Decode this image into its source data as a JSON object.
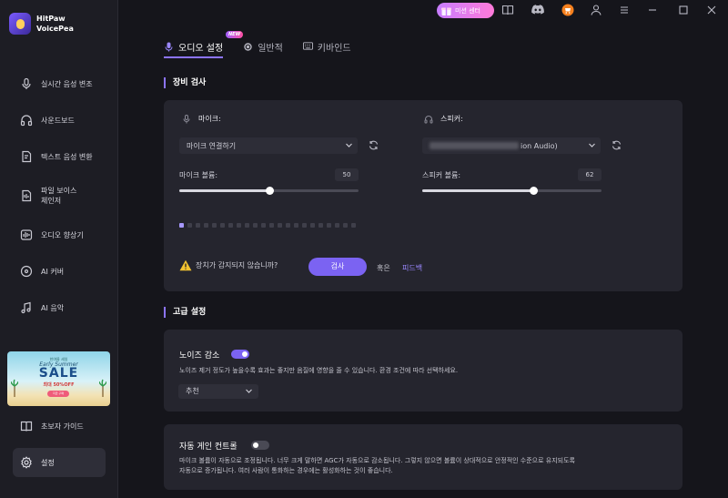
{
  "app": {
    "name_line1": "HitPaw",
    "name_line2": "VoicePea"
  },
  "sidebar": {
    "items": [
      {
        "label": "실시간 음성 변조",
        "icon": "mic-wave-icon"
      },
      {
        "label": "사운드보드",
        "icon": "headphones-icon"
      },
      {
        "label": "텍스트 음성 변환",
        "icon": "text-to-speech-icon"
      },
      {
        "label_line1": "파일 보이스",
        "label_line2": "체인저",
        "icon": "file-voice-icon"
      },
      {
        "label": "오디오 향상기",
        "icon": "audio-enhance-icon"
      },
      {
        "label": "AI 커버",
        "icon": "ai-cover-icon"
      },
      {
        "label": "AI 음악",
        "icon": "ai-music-icon"
      }
    ],
    "guide_label": "초보자 가이드",
    "settings_label": "설정",
    "banner": {
      "top": "한여름 세일",
      "subtitle": "Early Summer",
      "title": "SALE",
      "discount": "최대 50%OFF",
      "button": "지금 구매"
    }
  },
  "topbar": {
    "mission_label": "미션 센터"
  },
  "tabs": [
    {
      "label": "오디오 설정",
      "active": true,
      "badge": "NEW"
    },
    {
      "label": "일반적",
      "active": false
    },
    {
      "label": "키바인드",
      "active": false
    }
  ],
  "device_check": {
    "title": "장비 검사",
    "mic": {
      "label": "마이크:",
      "selected": "마이크 연결하기",
      "volume_label": "마이크 볼륨:",
      "volume": 50
    },
    "speaker": {
      "label": "스피커:",
      "selected_suffix": "ion Audio)",
      "volume_label": "스피커 볼륨:",
      "volume": 62
    },
    "meter_total": 22,
    "meter_active": 1,
    "warning_text": "장치가 감지되지 않습니까?",
    "check_button": "검사",
    "or_text": "혹은",
    "feedback_link": "피드백"
  },
  "advanced": {
    "title": "고급 설정",
    "noise": {
      "title": "노이즈 감소",
      "enabled": true,
      "description": "노이즈 제거 정도가 높을수록 효과는 좋지만 음질에 영향을 줄 수 있습니다. 환경 조건에 따라 선택하세요.",
      "selected": "추천"
    },
    "agc": {
      "title": "자동 게인 컨트롤",
      "enabled": false,
      "description_line1": "마이크 볼륨이 자동으로 조정됩니다. 너무 크게 말하면 AGC가 자동으로 감소됩니다. 그렇지 않으면 볼륨이 상대적으로 안정적인 수준으로 유지되도록",
      "description_line2": "자동으로 증가됩니다. 여러 사람이 통화하는 경우에는 활성화하는 것이 좋습니다."
    }
  },
  "colors": {
    "accent": "#7b63f2",
    "background": "#15151b",
    "card": "#25252e"
  }
}
